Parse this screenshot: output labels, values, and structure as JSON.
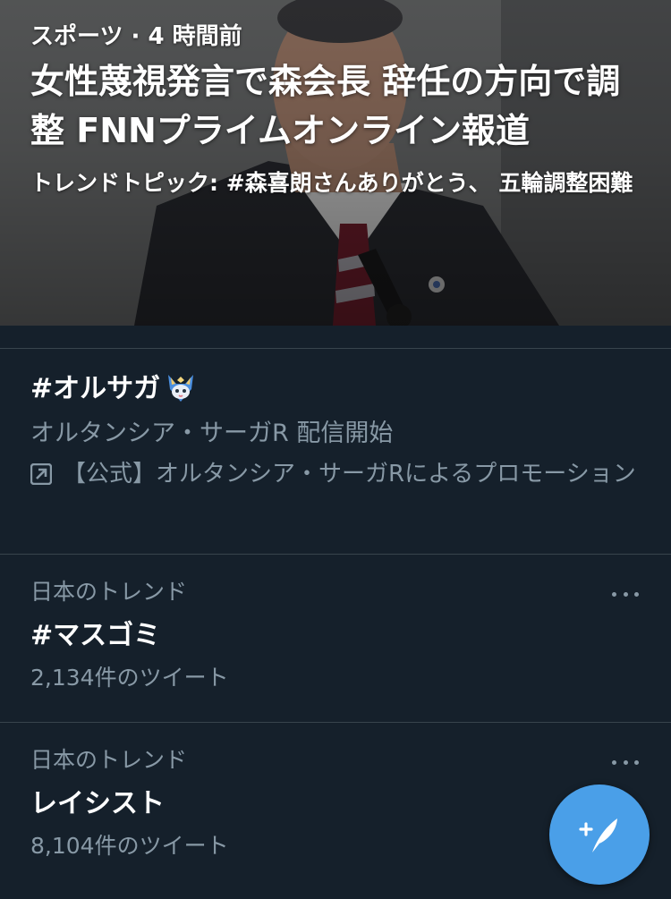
{
  "news": {
    "meta": "スポーツ · 4 時間前",
    "headline": "女性蔑視発言で森会長 辞任の方向で調整 FNNプライムオンライン報道",
    "subtitle": "トレンドトピック: #森喜朗さんありがとう、 五輪調整困難"
  },
  "promoted": {
    "hashtag": "#オルサガ",
    "description": "オルタンシア・サーガR 配信開始",
    "promoted_by": "【公式】オルタンシア・サーガRによるプロモーション",
    "icon": "promoted-arrow-icon"
  },
  "trends": [
    {
      "context": "日本のトレンド",
      "title": "#マスゴミ",
      "count": "2,134件のツイート"
    },
    {
      "context": "日本のトレンド",
      "title": "レイシスト",
      "count": "8,104件のツイート"
    }
  ],
  "compose": {
    "icon": "compose-tweet-icon",
    "color": "#4a9fe8"
  },
  "colors": {
    "background": "#15202b",
    "secondary_text": "#8899a6",
    "divider": "#38444d"
  }
}
